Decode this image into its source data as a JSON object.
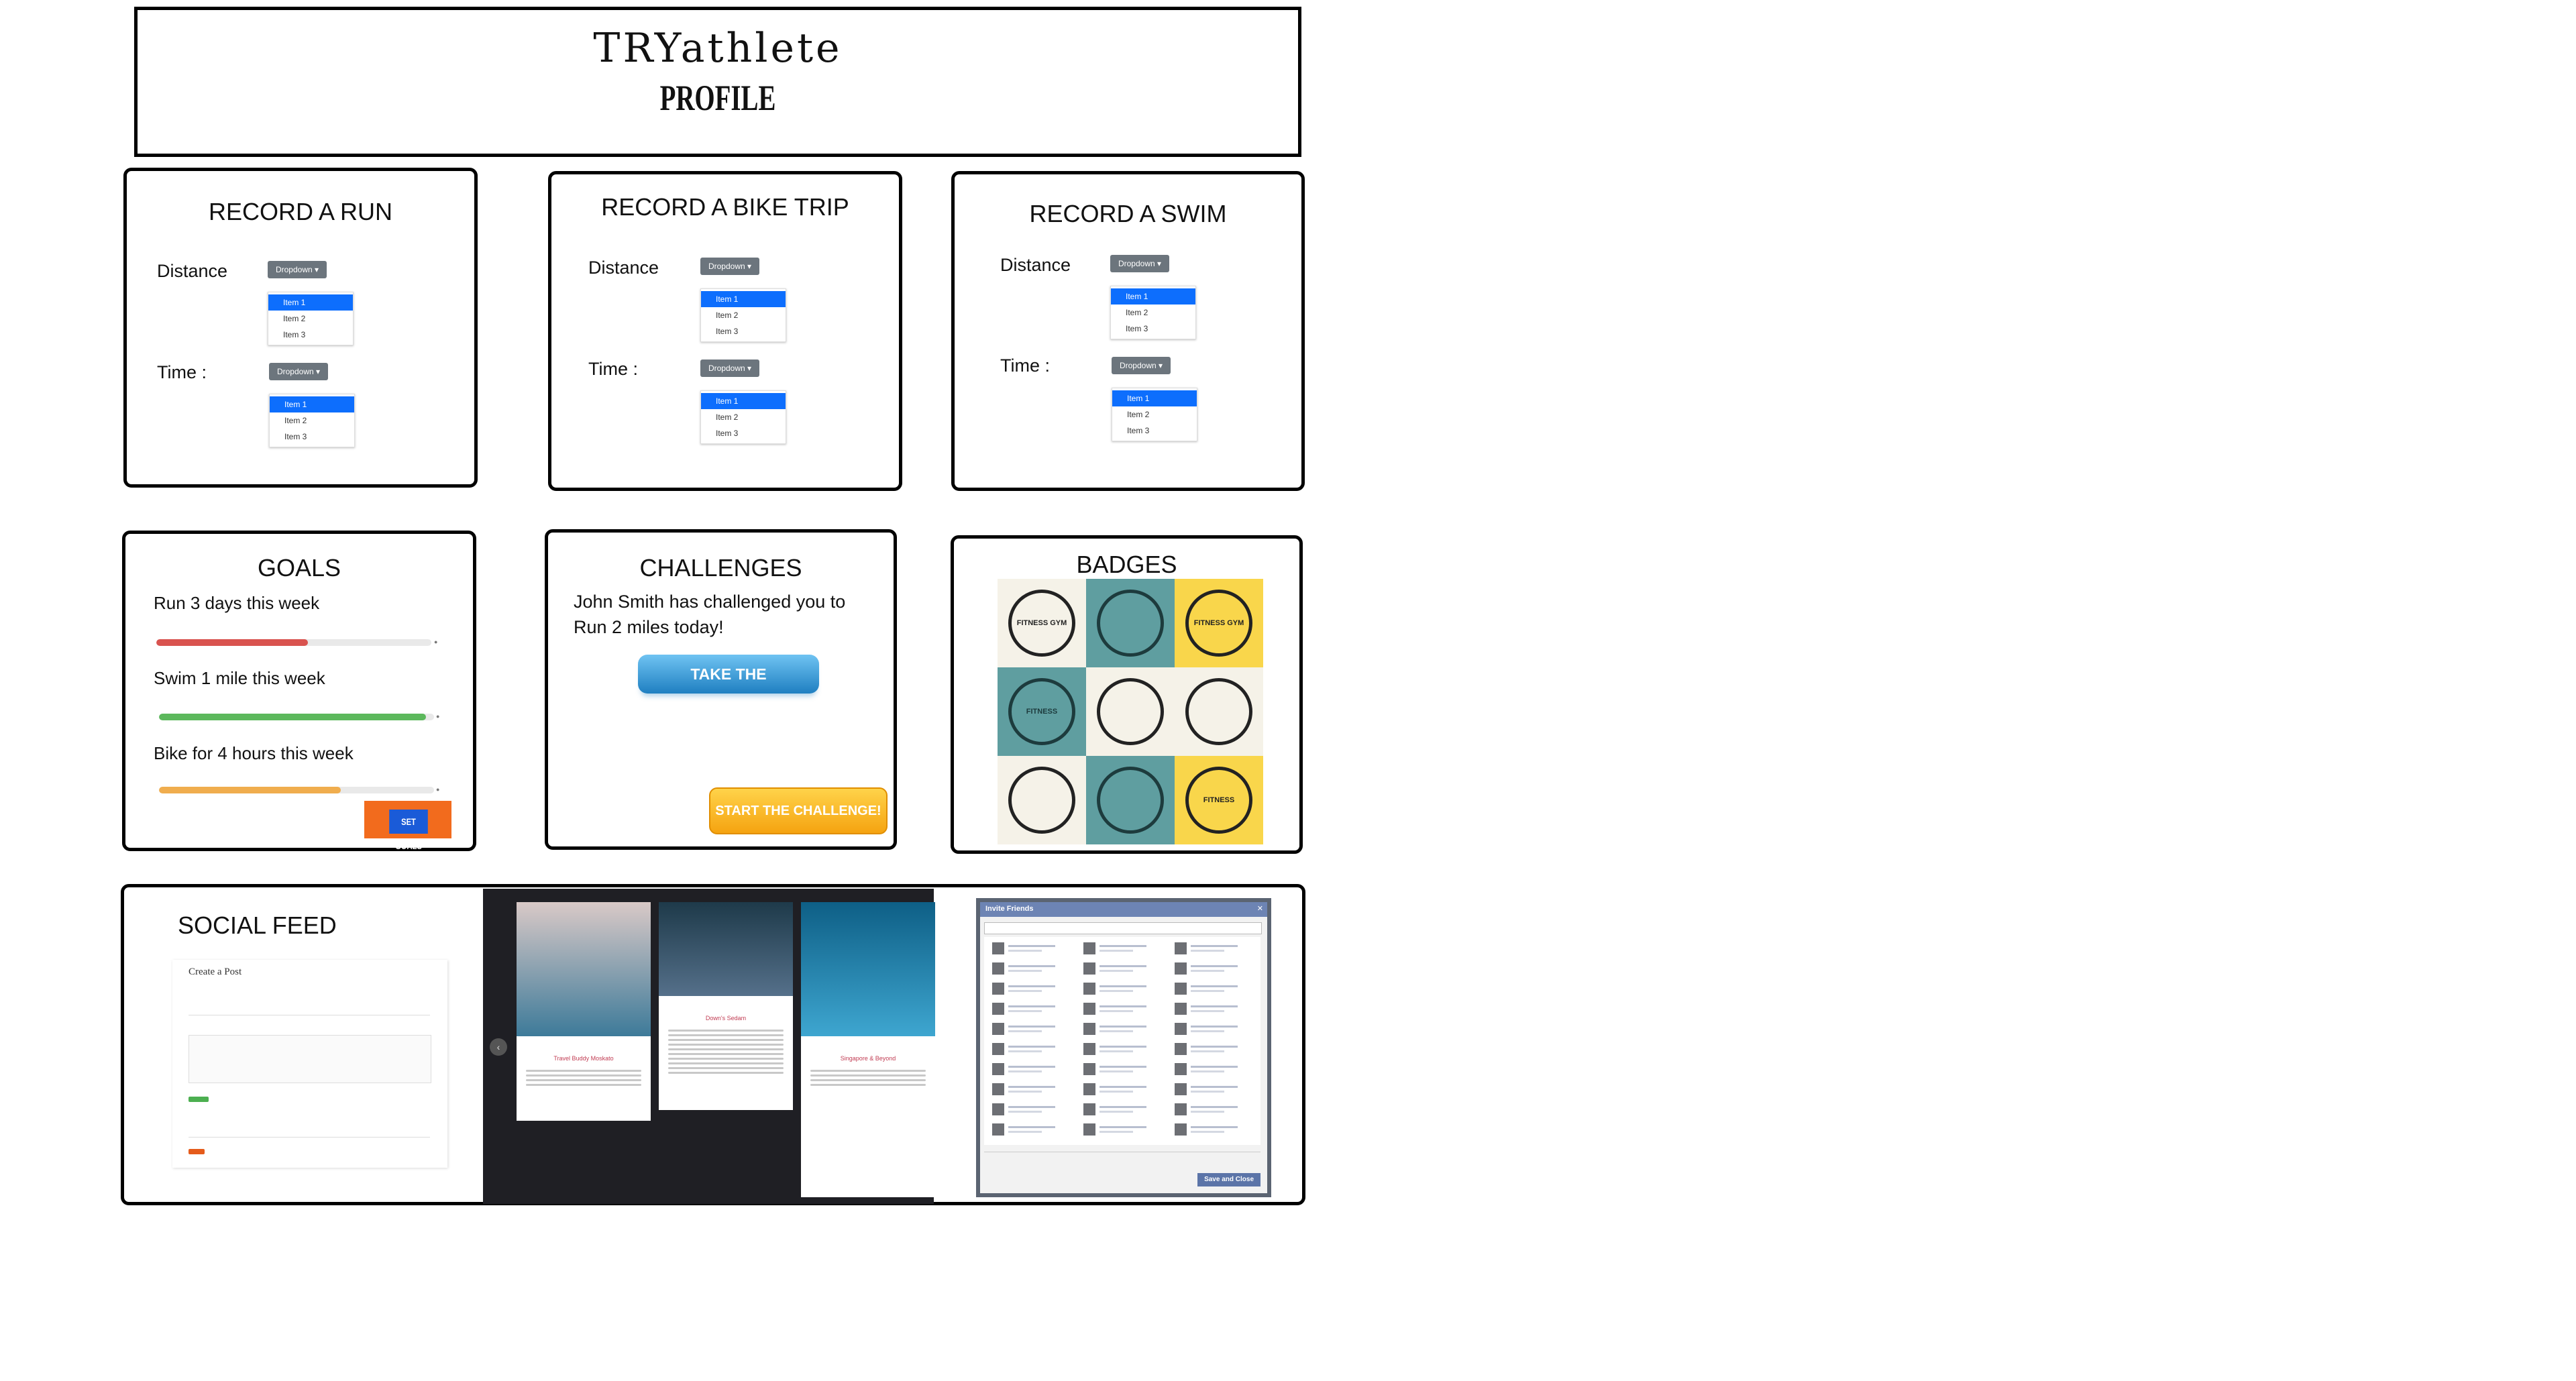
{
  "app": {
    "logo_text": "TRYathlete",
    "page_title": "PROFILE"
  },
  "run": {
    "title": "RECORD A RUN",
    "distance_label": "Distance",
    "time_label": "Time :",
    "dropdown_label": "Dropdown ▾",
    "items": [
      "Item 1",
      "Item 2",
      "Item 3"
    ]
  },
  "bike": {
    "title": "RECORD A BIKE TRIP",
    "distance_label": "Distance",
    "time_label": "Time :",
    "dropdown_label": "Dropdown ▾",
    "items": [
      "Item 1",
      "Item 2",
      "Item 3"
    ]
  },
  "swim": {
    "title": "RECORD A SWIM",
    "distance_label": "Distance",
    "time_label": "Time :",
    "dropdown_label": "Dropdown ▾",
    "items": [
      "Item 1",
      "Item 2",
      "Item 3"
    ]
  },
  "goals": {
    "title": "GOALS",
    "items": [
      {
        "label": "Run 3 days this week",
        "progress": 0.55,
        "color": "#d9534f"
      },
      {
        "label": "Swim 1 mile this week",
        "progress": 0.97,
        "color": "#5cb85c"
      },
      {
        "label": "Bike for 4 hours this week",
        "progress": 0.66,
        "color": "#f0ad4e"
      }
    ],
    "button_label": "SET GOALS"
  },
  "challenges": {
    "title": "CHALLENGES",
    "message_line1": "John Smith has challenged you to",
    "message_line2": "Run 2 miles today!",
    "take_label": "TAKE THE CHALLENGE!!",
    "start_label": "START THE CHALLENGE!"
  },
  "badges": {
    "title": "BADGES",
    "tiles": [
      {
        "bg": "#f5f2e8",
        "fg": "#222",
        "icon": "bodybuilder-badge-icon",
        "text": "FITNESS GYM"
      },
      {
        "bg": "#5f9ea0",
        "fg": "#1d3b3d",
        "icon": "wreath-badge-icon",
        "text": ""
      },
      {
        "bg": "#f9d64b",
        "fg": "#222",
        "icon": "fitness-gym-badge-icon",
        "text": "FITNESS GYM"
      },
      {
        "bg": "#5f9ea0",
        "fg": "#1d3b3d",
        "icon": "shield-badge-icon",
        "text": "FITNESS"
      },
      {
        "bg": "#f5f2e8",
        "fg": "#222",
        "icon": "crossed-dumbbells-badge-icon",
        "text": ""
      },
      {
        "bg": "#f5f2e8",
        "fg": "#222",
        "icon": "dumbbell-badge-icon",
        "text": ""
      },
      {
        "bg": "#f5f2e8",
        "fg": "#222",
        "icon": "kettlebell-badge-icon",
        "text": ""
      },
      {
        "bg": "#5f9ea0",
        "fg": "#1d3b3d",
        "icon": "gear-badge-icon",
        "text": ""
      },
      {
        "bg": "#f9d64b",
        "fg": "#222",
        "icon": "barbell-badge-icon",
        "text": "FITNESS"
      }
    ]
  },
  "social": {
    "title": "SOCIAL FEED",
    "create_post_title": "Create a Post",
    "posts": [
      {
        "title": "Travel Buddy Moskato",
        "img_top": "#d9c9c7",
        "img_bottom": "#3d7a99"
      },
      {
        "title": "Down's Sedam",
        "img_top": "#1e3a4a",
        "img_bottom": "#55708a"
      },
      {
        "title": "Singapore & Beyond",
        "img_top": "#0e5f86",
        "img_bottom": "#3ea6d0"
      }
    ],
    "invite_title": "Invite Friends",
    "invite_button": "Save and Close"
  }
}
